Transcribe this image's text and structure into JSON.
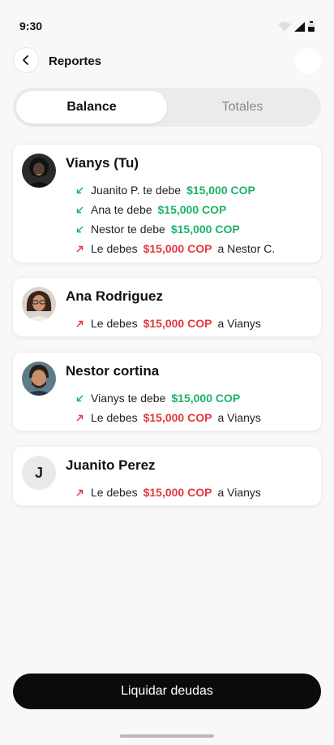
{
  "status": {
    "time": "9:30"
  },
  "header": {
    "title": "Reportes"
  },
  "tabs": [
    {
      "label": "Balance",
      "active": true
    },
    {
      "label": "Totales",
      "active": false
    }
  ],
  "cards": [
    {
      "name": "Vianys (Tu)",
      "avatar": "photo",
      "lines": [
        {
          "direction": "in",
          "text": "Juanito P. te debe",
          "amount": "$15,000 COP",
          "suffix": ""
        },
        {
          "direction": "in",
          "text": "Ana te debe",
          "amount": "$15,000 COP",
          "suffix": ""
        },
        {
          "direction": "in",
          "text": "Nestor te debe",
          "amount": "$15,000 COP",
          "suffix": ""
        },
        {
          "direction": "out",
          "text": "Le debes",
          "amount": "$15,000 COP",
          "suffix": "a Nestor C."
        }
      ]
    },
    {
      "name": "Ana Rodriguez",
      "avatar": "photo",
      "lines": [
        {
          "direction": "out",
          "text": "Le debes",
          "amount": "$15,000 COP",
          "suffix": "a Vianys"
        }
      ]
    },
    {
      "name": "Nestor cortina",
      "avatar": "photo",
      "lines": [
        {
          "direction": "in",
          "text": "Vianys te debe",
          "amount": "$15,000 COP",
          "suffix": ""
        },
        {
          "direction": "out",
          "text": "Le debes",
          "amount": "$15,000 COP",
          "suffix": "a Vianys"
        }
      ]
    },
    {
      "name": "Juanito Perez",
      "avatar": "initial",
      "initial": "J",
      "lines": [
        {
          "direction": "out",
          "text": "Le debes",
          "amount": "$15,000 COP",
          "suffix": "a Vianys"
        }
      ]
    }
  ],
  "footer": {
    "button_label": "Liquidar deudas"
  },
  "colors": {
    "positive": "#1bb36a",
    "negative": "#e5383b",
    "primary": "#0b0b0b"
  },
  "icons": {
    "in": "arrow-down-left-icon",
    "out": "arrow-up-right-icon",
    "back": "chevron-left-icon"
  }
}
